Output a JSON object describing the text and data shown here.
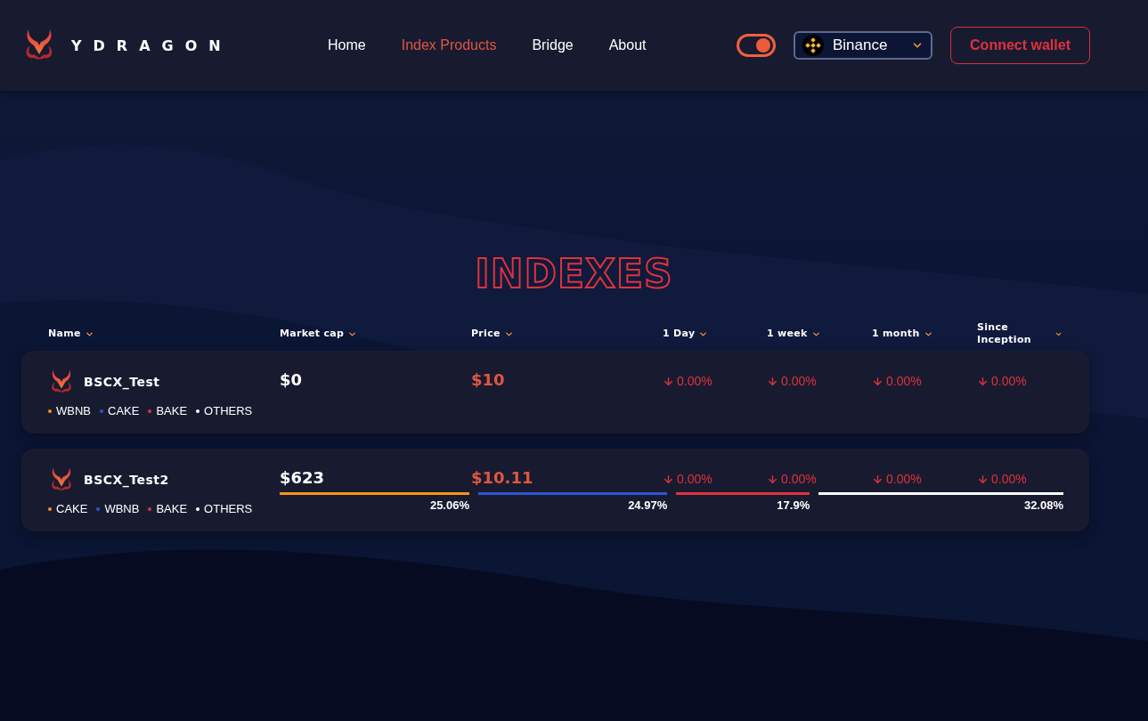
{
  "header": {
    "brand": "YDRAGON",
    "nav": [
      {
        "label": "Home",
        "selected": false
      },
      {
        "label": "Index Products",
        "selected": true
      },
      {
        "label": "Bridge",
        "selected": false
      },
      {
        "label": "About",
        "selected": false
      }
    ],
    "theme_toggle": {
      "on": true
    },
    "network": {
      "label": "Binance"
    },
    "connect_button": "Connect wallet"
  },
  "title": "INDEXES",
  "table": {
    "columns": [
      "Name",
      "Market cap",
      "Price",
      "1 Day",
      "1 week",
      "1 month",
      "Since Inception"
    ],
    "rows": [
      {
        "name": "BSCX_Test",
        "market_cap": "$0",
        "price": "$10",
        "changes": [
          "0.00%",
          "0.00%",
          "0.00%",
          "0.00%"
        ],
        "tokens": [
          {
            "label": "WBNB",
            "color": "#f7931a"
          },
          {
            "label": "CAKE",
            "color": "#2f55d4"
          },
          {
            "label": "BAKE",
            "color": "#e0323b"
          },
          {
            "label": "OTHERS",
            "color": "#ffffff"
          }
        ]
      },
      {
        "name": "BSCX_Test2",
        "market_cap": "$623",
        "price": "$10.11",
        "changes": [
          "0.00%",
          "0.00%",
          "0.00%",
          "0.00%"
        ],
        "tokens": [
          {
            "label": "CAKE",
            "color": "#f7931a"
          },
          {
            "label": "WBNB",
            "color": "#2f55d4"
          },
          {
            "label": "BAKE",
            "color": "#e0323b"
          },
          {
            "label": "OTHERS",
            "color": "#ffffff"
          }
        ],
        "composition": [
          {
            "label": "25.06%",
            "color": "#f7931a"
          },
          {
            "label": "24.97%",
            "color": "#2f55d4"
          },
          {
            "label": "17.9%",
            "color": "#e0323b"
          },
          {
            "label": "32.08%",
            "color": "#ffffff"
          }
        ]
      }
    ]
  }
}
